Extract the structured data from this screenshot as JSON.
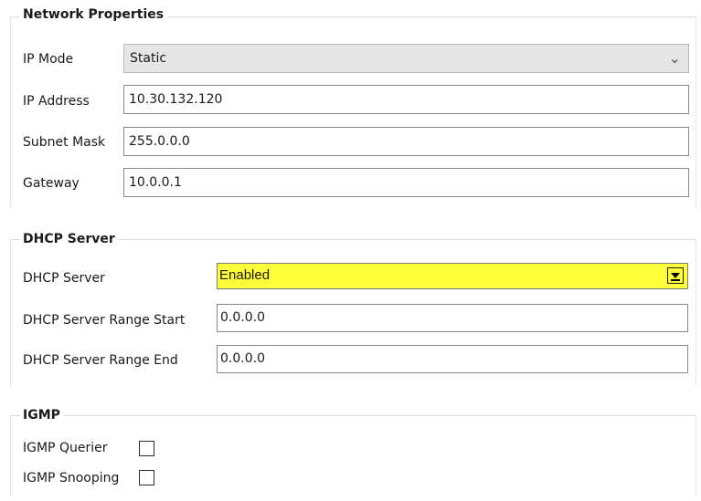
{
  "network": {
    "title": "Network Properties",
    "ip_mode_label": "IP Mode",
    "ip_mode_value": "Static",
    "ip_address_label": "IP Address",
    "ip_address_value": "10.30.132.120",
    "subnet_mask_label": "Subnet Mask",
    "subnet_mask_value": "255.0.0.0",
    "gateway_label": "Gateway",
    "gateway_value": "10.0.0.1"
  },
  "dhcp": {
    "title": "DHCP Server",
    "server_label": "DHCP Server",
    "server_value": "Enabled",
    "highlight_color": "#ffff3a",
    "range_start_label": "DHCP Server Range Start",
    "range_start_value": "0.0.0.0",
    "range_end_label": "DHCP Server Range End",
    "range_end_value": "0.0.0.0"
  },
  "igmp": {
    "title": "IGMP",
    "querier_label": "IGMP Querier",
    "querier_checked": false,
    "snooping_label": "IGMP Snooping",
    "snooping_checked": false
  }
}
